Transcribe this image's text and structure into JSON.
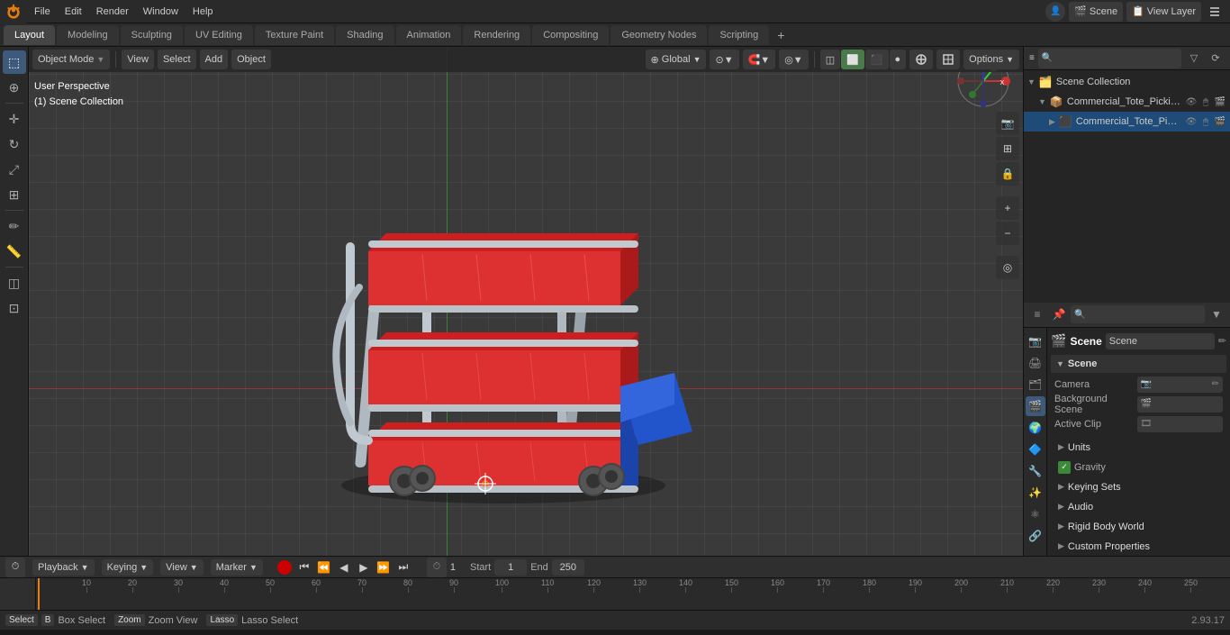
{
  "app": {
    "title": "Blender",
    "version": "2.93.17"
  },
  "top_menu": {
    "items": [
      "Blender",
      "File",
      "Edit",
      "Render",
      "Window",
      "Help"
    ]
  },
  "workspace_tabs": {
    "items": [
      "Layout",
      "Modeling",
      "Sculpting",
      "UV Editing",
      "Texture Paint",
      "Shading",
      "Animation",
      "Rendering",
      "Compositing",
      "Geometry Nodes",
      "Scripting"
    ],
    "active": "Layout"
  },
  "header_toolbar": {
    "mode": "Object Mode",
    "view_label": "View",
    "select_label": "Select",
    "add_label": "Add",
    "object_label": "Object",
    "transform": "Global",
    "options_label": "Options"
  },
  "viewport": {
    "info_line1": "User Perspective",
    "info_line2": "(1) Scene Collection",
    "overlays": [
      "overlay",
      "xray",
      "shading"
    ],
    "shading_mode": "solid"
  },
  "outliner": {
    "title": "Scene Collection",
    "items": [
      {
        "label": "Commercial_Tote_Picking_Ca",
        "type": "collection",
        "expanded": true,
        "depth": 0
      },
      {
        "label": "Commercial_Tote_Picking",
        "type": "mesh",
        "expanded": false,
        "depth": 1
      }
    ]
  },
  "properties": {
    "scene_label": "Scene",
    "scene_name": "Scene",
    "sections": {
      "scene": {
        "label": "Scene",
        "expanded": true
      },
      "camera_row": {
        "label": "Camera",
        "value": ""
      },
      "background_scene_row": {
        "label": "Background Scene"
      },
      "active_clip_row": {
        "label": "Active Clip"
      },
      "units": {
        "label": "Units",
        "collapsed": true
      },
      "gravity": {
        "label": "Gravity",
        "checked": true
      },
      "keying_sets": {
        "label": "Keying Sets",
        "collapsed": true
      },
      "audio": {
        "label": "Audio",
        "collapsed": true
      },
      "rigid_body_world": {
        "label": "Rigid Body World",
        "collapsed": true
      },
      "custom_properties": {
        "label": "Custom Properties",
        "collapsed": true
      }
    },
    "icons": [
      "render",
      "output",
      "view_layer",
      "scene",
      "world",
      "object",
      "modifier",
      "particles",
      "physics",
      "constraints"
    ]
  },
  "timeline": {
    "playback_label": "Playback",
    "keying_label": "Keying",
    "view_label": "View",
    "marker_label": "Marker",
    "current_frame": "1",
    "start_label": "Start",
    "start_value": "1",
    "end_label": "End",
    "end_value": "250",
    "tick_marks": [
      "10",
      "20",
      "30",
      "40",
      "50",
      "60",
      "70",
      "80",
      "90",
      "100",
      "110",
      "120",
      "130",
      "140",
      "150",
      "160",
      "170",
      "180",
      "190",
      "200",
      "210",
      "220",
      "230",
      "240",
      "250"
    ]
  },
  "status_bar": {
    "select_key": "Select",
    "box_select_label": "Box Select",
    "zoom_label": "Zoom View",
    "lasso_select_label": "Lasso Select"
  }
}
